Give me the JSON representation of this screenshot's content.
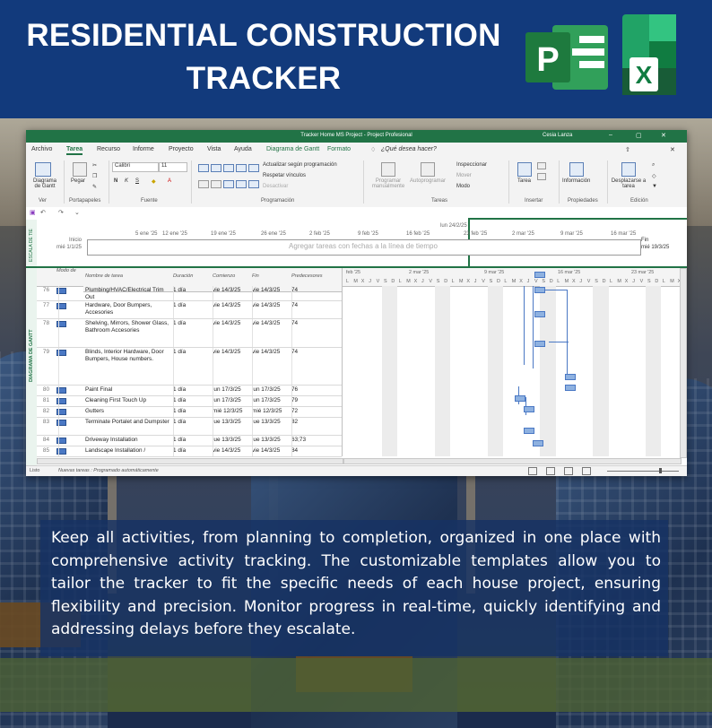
{
  "header": {
    "title_line1": "RESIDENTIAL CONSTRUCTION",
    "title_line2": "TRACKER",
    "logos": [
      "ms-project-logo",
      "ms-excel-logo"
    ]
  },
  "window": {
    "title": "Tracker Home MS Project  -  Project Profesional",
    "user": "Cesia Lanza",
    "tabs": [
      "Archivo",
      "Tarea",
      "Recurso",
      "Informe",
      "Proyecto",
      "Vista",
      "Ayuda",
      "Diagrama de Gantt",
      "Formato"
    ],
    "active_tab": "Tarea",
    "search_hint": "¿Qué desea hacer?",
    "ribbon": {
      "ver": {
        "btn": "Diagrama de Gantt",
        "label": "Ver"
      },
      "portapapeles": {
        "btn": "Pegar",
        "label": "Portapapeles"
      },
      "fuente": {
        "font": "Calibri",
        "size": "11",
        "label": "Fuente"
      },
      "programacion": {
        "items": [
          "Actualizar según programación",
          "Respetar vínculos",
          "Desactivar"
        ],
        "label": "Programación"
      },
      "tareas": {
        "programar_manual": "Programar manualmente",
        "autoprogramar": "Autoprogramar",
        "inspeccionar": "Inspeccionar",
        "mover": "Mover",
        "modo": "Modo",
        "label": "Tareas"
      },
      "insertar": {
        "btn": "Tarea",
        "label": "Insertar"
      },
      "propiedades": {
        "btn": "Información",
        "label": "Propiedades"
      },
      "edicion": {
        "btn": "Desplazarse a tarea",
        "label": "Edición"
      }
    },
    "timeline": {
      "side_label": "ESCALA DE TIE",
      "inicio_label": "Inicio",
      "inicio_date": "mié 1/1/25",
      "fin_label": "Fin",
      "fin_date": "mié 19/3/25",
      "today": "lun 24/2/25",
      "dates": [
        "5 ene '25",
        "12 ene '25",
        "19 ene '25",
        "26 ene '25",
        "2 feb '25",
        "9 feb '25",
        "16 feb '25",
        "23 feb '25",
        "2 mar '25",
        "9 mar '25",
        "16 mar '25"
      ],
      "hint": "Agregar tareas con fechas a la línea de tiempo"
    },
    "grid": {
      "side_label": "DIAGRAMA DE GANTT",
      "headers": [
        "Modo de",
        "Nombre de tarea",
        "Duración",
        "Comienzo",
        "Fin",
        "Predecesores"
      ],
      "rows": [
        {
          "id": "76",
          "name": "Plumbing/HVAC/Electrical Trim Out",
          "dur": "1 día",
          "start": "vie 14/3/25",
          "end": "vie 14/3/25",
          "pred": "74"
        },
        {
          "id": "77",
          "name": "Hardware, Door Bumpers, Accesories",
          "dur": "1 día",
          "start": "vie 14/3/25",
          "end": "vie 14/3/25",
          "pred": "74"
        },
        {
          "id": "78",
          "name": "Shelving, Mirrors, Shower Glass, Bathroom Accesories",
          "dur": "1 día",
          "start": "vie 14/3/25",
          "end": "vie 14/3/25",
          "pred": "74"
        },
        {
          "id": "79",
          "name": "Blinds, Interior Hardware, Door Bumpers, House numbers.",
          "dur": "1 día",
          "start": "vie 14/3/25",
          "end": "vie 14/3/25",
          "pred": "74"
        },
        {
          "id": "80",
          "name": "Paint Final",
          "dur": "1 día",
          "start": "lun 17/3/25",
          "end": "lun 17/3/25",
          "pred": "76"
        },
        {
          "id": "81",
          "name": "Cleaning First Touch Up",
          "dur": "1 día",
          "start": "lun 17/3/25",
          "end": "lun 17/3/25",
          "pred": "79"
        },
        {
          "id": "82",
          "name": "Gutters",
          "dur": "1 día",
          "start": "mié 12/3/25",
          "end": "mié 12/3/25",
          "pred": "72"
        },
        {
          "id": "83",
          "name": "Terminate Portalet and Dumpster",
          "dur": "1 día",
          "start": "jue 13/3/25",
          "end": "jue 13/3/25",
          "pred": "82"
        },
        {
          "id": "84",
          "name": "Driveway Installation",
          "dur": "1 día",
          "start": "jue 13/3/25",
          "end": "jue 13/3/25",
          "pred": "63;73"
        },
        {
          "id": "85",
          "name": "Landscape Installation /",
          "dur": "1 día",
          "start": "vie 14/3/25",
          "end": "vie 14/3/25",
          "pred": "84"
        }
      ]
    },
    "gantt": {
      "weeks": [
        "feb '25",
        "2 mar '25",
        "9 mar '25",
        "16 mar '25",
        "23 mar '25"
      ],
      "days": [
        "L",
        "M",
        "X",
        "J",
        "V",
        "S",
        "D",
        "L",
        "M",
        "X",
        "J",
        "V",
        "S",
        "D",
        "L",
        "M",
        "X",
        "J",
        "V",
        "S",
        "D",
        "L",
        "M",
        "X",
        "J",
        "V",
        "S",
        "D",
        "L",
        "M",
        "X",
        "J",
        "V",
        "S",
        "D",
        "L",
        "M",
        "X",
        "J",
        "V",
        "S",
        "D",
        "L",
        "M",
        "X"
      ]
    },
    "status": {
      "ready": "Listo",
      "new_tasks": "Nuevas tareas : Programado automáticamente"
    }
  },
  "description": "Keep all activities, from planning to completion, organized in one place with comprehensive activity tracking. The customizable templates allow you to tailor the tracker to fit the specific needs of each house project, ensuring flexibility and precision. Monitor progress in real-time, quickly identifying and addressing delays before they escalate.",
  "colors": {
    "header_bg": "#123a7c",
    "project_green": "#217346",
    "bar_blue": "#8eb1e0"
  }
}
